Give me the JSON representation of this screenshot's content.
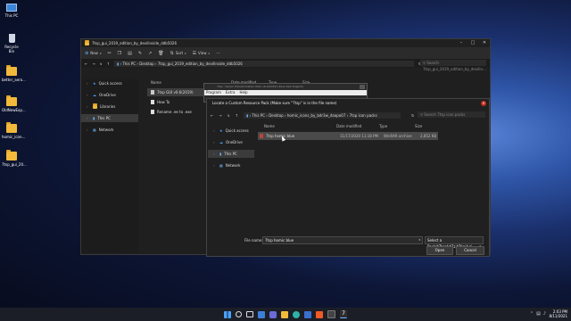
{
  "desktop": [
    {
      "label": "This PC",
      "icon": "this-pc-icon"
    },
    {
      "label": "Recycle Bin",
      "icon": "recycle-bin-icon"
    },
    {
      "label": "better_aero...",
      "icon": "folder-icon"
    },
    {
      "label": "OldNewExp...",
      "icon": "folder-icon"
    },
    {
      "label": "homic_icon...",
      "icon": "folder-icon"
    },
    {
      "label": "7tsp_gui_20...",
      "icon": "folder-icon"
    }
  ],
  "explorer": {
    "title": "7tsp_gui_2019_edition_by_devillnside_ddb5026",
    "toolbar": {
      "new": "New",
      "sort": "Sort",
      "view": "View"
    },
    "path": [
      "This PC",
      "Desktop",
      "7tsp_gui_2019_edition_by_devillnside_ddb5026"
    ],
    "search_placeholder": "Search 7tsp_gui_2019_edition_by_devilln...",
    "nav": [
      {
        "label": "Quick access",
        "icon": "star-icon"
      },
      {
        "label": "OneDrive",
        "icon": "cloud-icon"
      },
      {
        "label": "Libraries",
        "icon": "folder-icon"
      },
      {
        "label": "This PC",
        "icon": "computer-icon",
        "selected": true
      },
      {
        "label": "Network",
        "icon": "network-icon"
      }
    ],
    "columns": {
      "name": "Name",
      "date": "Date modified",
      "type": "Type",
      "size": "Size"
    },
    "files": [
      "7tsp GUI v0.6(2019)",
      "How To",
      "Rename .ee to .exe"
    ]
  },
  "background_window": {
    "title": "7tsp - Seven Transformation Pack v6.4(2019) (blue dark English)",
    "menu": [
      "Program",
      "Extra",
      "Help"
    ]
  },
  "dialog": {
    "title": "Locate a Custom Resource Pack (Make sure \"7tsp\" is in the file name)",
    "path": [
      "This PC",
      "Desktop",
      "homic_icons_by_bdr3w_daapo07",
      "7tsp icon packs"
    ],
    "search_placeholder": "Search 7tsp icon packs",
    "nav": [
      {
        "label": "Quick access",
        "icon": "star-icon"
      },
      {
        "label": "OneDrive",
        "icon": "cloud-icon"
      },
      {
        "label": "This PC",
        "icon": "computer-icon",
        "selected": true
      },
      {
        "label": "Network",
        "icon": "network-icon"
      }
    ],
    "columns": {
      "name": "Name",
      "date": "Date modified",
      "type": "Type",
      "size": "Size"
    },
    "files": [
      {
        "name": "7tsp homic blue",
        "date": "11/17/2020 11:18 PM",
        "type": "WinRAR archive",
        "size": "2,852 KB"
      }
    ],
    "filename_label": "File name:",
    "filename_value": "7tsp homic blue",
    "filter": "Select a Pack(*7tsp*;*7z;*7tsp*.zi",
    "open": "Open",
    "cancel": "Cancel"
  },
  "taskbar": {
    "time": "2:03 PM",
    "date": "8/11/2021",
    "apps": [
      "start-icon",
      "search-icon",
      "task-view-icon",
      "widgets-icon",
      "chat-icon",
      "file-explorer-icon",
      "edge-icon",
      "store-icon",
      "brave-icon",
      "terminal-icon",
      "7tsp-icon"
    ]
  }
}
